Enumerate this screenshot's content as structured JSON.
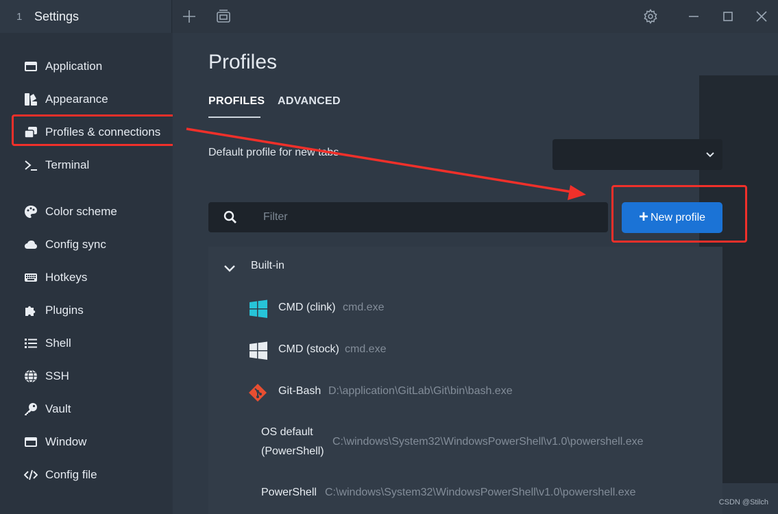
{
  "window": {
    "tab_number": "1",
    "tab_title": "Settings"
  },
  "sidebar": {
    "items": [
      {
        "label": "Application",
        "icon": "application-icon"
      },
      {
        "label": "Appearance",
        "icon": "appearance-icon"
      },
      {
        "label": "Profiles & connections",
        "icon": "profiles-icon"
      },
      {
        "label": "Terminal",
        "icon": "terminal-icon"
      },
      {
        "label": "Color scheme",
        "icon": "palette-icon"
      },
      {
        "label": "Config sync",
        "icon": "cloud-icon"
      },
      {
        "label": "Hotkeys",
        "icon": "keyboard-icon"
      },
      {
        "label": "Plugins",
        "icon": "puzzle-icon"
      },
      {
        "label": "Shell",
        "icon": "list-icon"
      },
      {
        "label": "SSH",
        "icon": "globe-icon"
      },
      {
        "label": "Vault",
        "icon": "key-icon"
      },
      {
        "label": "Window",
        "icon": "window-icon"
      },
      {
        "label": "Config file",
        "icon": "code-icon"
      }
    ]
  },
  "main": {
    "title": "Profiles",
    "tabs": [
      {
        "label": "PROFILES",
        "active": true
      },
      {
        "label": "ADVANCED",
        "active": false
      }
    ],
    "default_profile_label": "Default profile for new tabs",
    "default_profile_value": "",
    "filter_placeholder": "Filter",
    "new_profile_label": "New profile",
    "group": {
      "title": "Built-in",
      "profiles": [
        {
          "name": "CMD (clink)",
          "command": "cmd.exe",
          "icon": "windows-icon"
        },
        {
          "name": "CMD (stock)",
          "command": "cmd.exe",
          "icon": "windows-icon"
        },
        {
          "name": "Git-Bash",
          "command": "D:\\application\\GitLab\\Git\\bin\\bash.exe",
          "icon": "git-icon"
        },
        {
          "name": "OS default",
          "name_line2": "(PowerShell)",
          "command": "C:\\windows\\System32\\WindowsPowerShell\\v1.0\\powershell.exe",
          "icon": ""
        },
        {
          "name": "PowerShell",
          "command": "C:\\windows\\System32\\WindowsPowerShell\\v1.0\\powershell.exe",
          "icon": ""
        }
      ]
    }
  },
  "watermark": "CSDN @Stilch",
  "colors": {
    "accent": "#1b73d6",
    "highlight": "#f0302a",
    "cmd_clink_icon": "#27c4d8",
    "git_icon": "#e84e31"
  }
}
